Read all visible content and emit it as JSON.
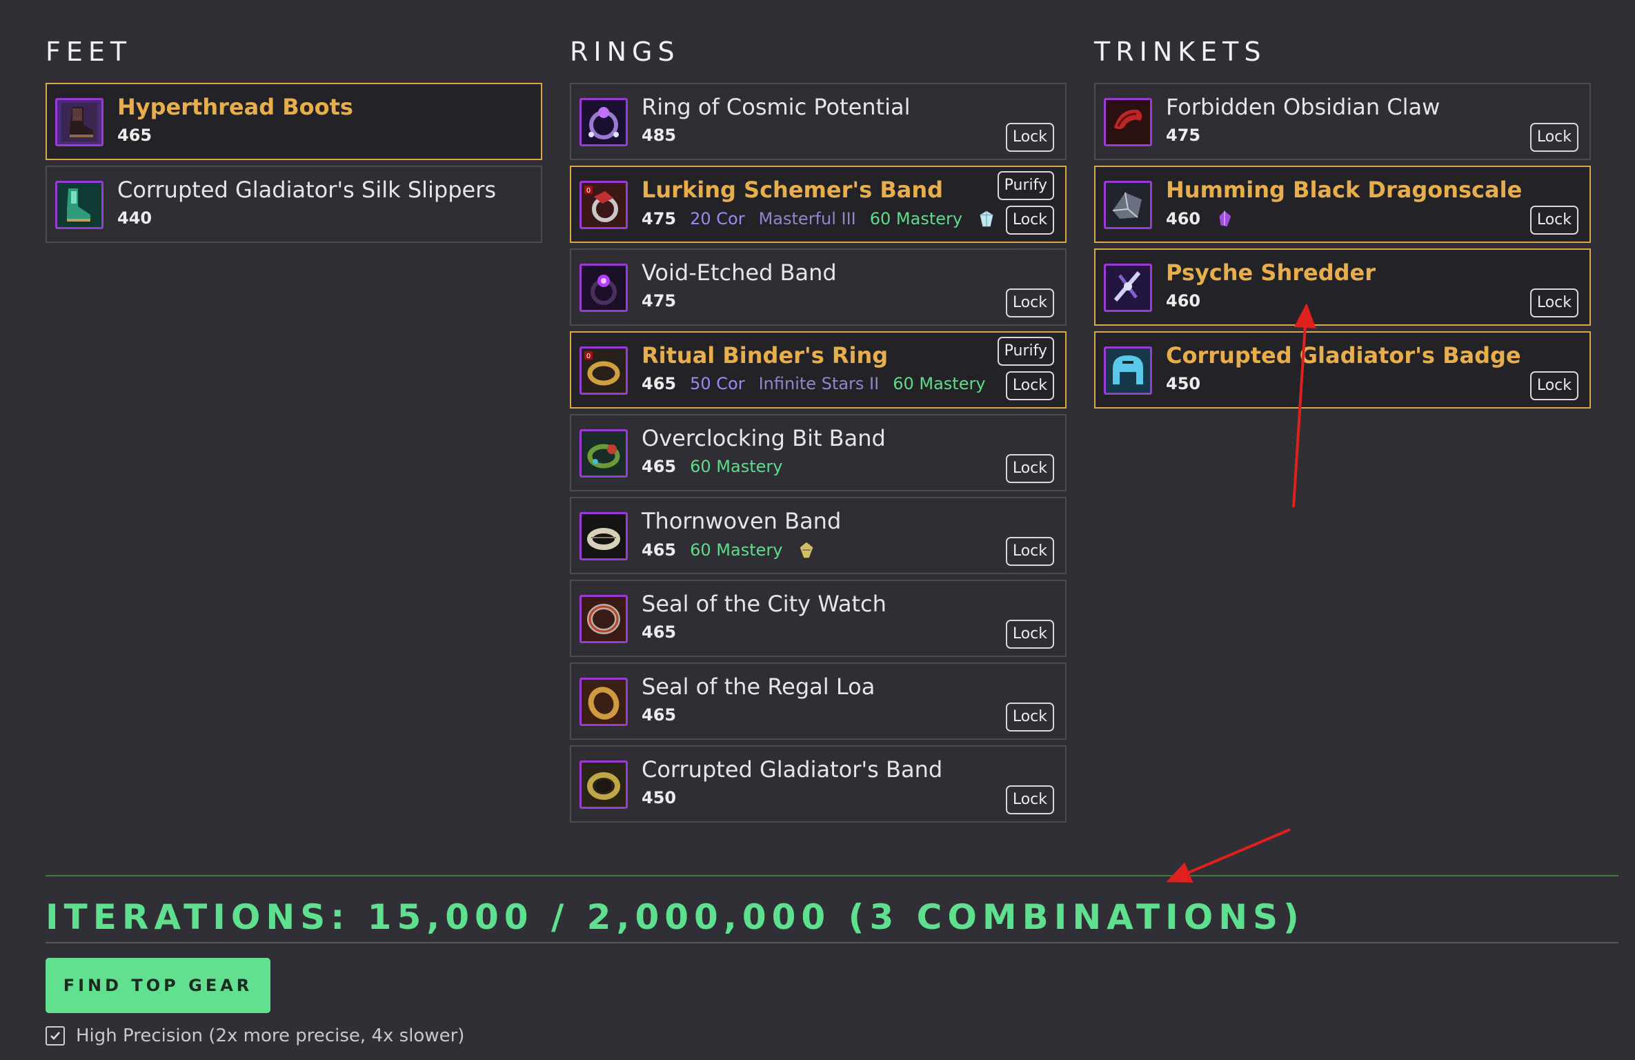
{
  "feet": {
    "title": "FEET",
    "items": [
      {
        "name": "Hyperthread Boots",
        "ilvl": "465"
      },
      {
        "name": "Corrupted Gladiator's Silk Slippers",
        "ilvl": "440"
      }
    ]
  },
  "rings": {
    "title": "RINGS",
    "items": [
      {
        "name": "Ring of Cosmic Potential",
        "ilvl": "485",
        "lock": "Lock"
      },
      {
        "name": "Lurking Schemer's Band",
        "ilvl": "475",
        "corruption": "20 Cor",
        "essence": "Masterful III",
        "mastery": "60 Mastery",
        "lock": "Lock",
        "purify": "Purify"
      },
      {
        "name": "Void-Etched Band",
        "ilvl": "475",
        "lock": "Lock"
      },
      {
        "name": "Ritual Binder's Ring",
        "ilvl": "465",
        "corruption": "50 Cor",
        "essence": "Infinite Stars II",
        "mastery": "60 Mastery",
        "lock": "Lock",
        "purify": "Purify"
      },
      {
        "name": "Overclocking Bit Band",
        "ilvl": "465",
        "mastery": "60 Mastery",
        "lock": "Lock"
      },
      {
        "name": "Thornwoven Band",
        "ilvl": "465",
        "mastery": "60 Mastery",
        "lock": "Lock"
      },
      {
        "name": "Seal of the City Watch",
        "ilvl": "465",
        "lock": "Lock"
      },
      {
        "name": "Seal of the Regal Loa",
        "ilvl": "465",
        "lock": "Lock"
      },
      {
        "name": "Corrupted Gladiator's Band",
        "ilvl": "450",
        "lock": "Lock"
      }
    ]
  },
  "trinkets": {
    "title": "TRINKETS",
    "items": [
      {
        "name": "Forbidden Obsidian Claw",
        "ilvl": "475",
        "lock": "Lock"
      },
      {
        "name": "Humming Black Dragonscale",
        "ilvl": "460",
        "lock": "Lock"
      },
      {
        "name": "Psyche Shredder",
        "ilvl": "460",
        "lock": "Lock"
      },
      {
        "name": "Corrupted Gladiator's Badge",
        "ilvl": "450",
        "lock": "Lock"
      }
    ]
  },
  "iterations": "ITERATIONS: 15,000 / 2,000,000 (3 COMBINATIONS)",
  "find_button": "FIND TOP GEAR",
  "high_precision": "High Precision (2x more precise, 4x slower)",
  "colors": {
    "background": "#2f2f35",
    "selected_border": "#d7a94a",
    "selected_name": "#e8ae4c",
    "icon_border": "#9b3bd6",
    "mastery": "#5fdc8a",
    "corruption": "#9a8af2",
    "accent_green": "#5ee08e",
    "annotation_arrow": "#e0201e"
  }
}
